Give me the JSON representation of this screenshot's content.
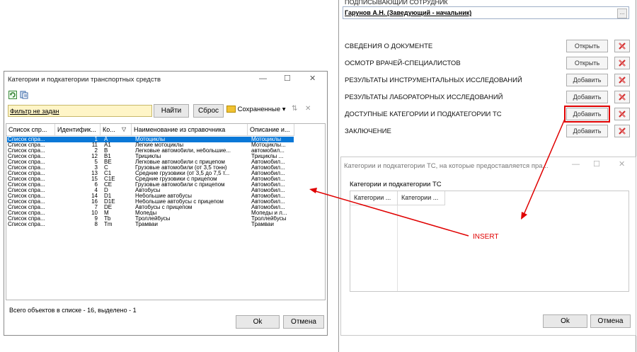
{
  "background_window": {
    "signer_label": "ПОДПИСЫВАЮЩИЙ СОТРУДНИК",
    "signer_value": "Гарунов А.Н. (Заведующий - начальник)",
    "ellipsis": "...",
    "sections": [
      {
        "label": "СВЕДЕНИЯ О ДОКУМЕНТЕ",
        "button": "Открыть"
      },
      {
        "label": "ОСМОТР ВРАЧЕЙ-СПЕЦИАЛИСТОВ",
        "button": "Открыть"
      },
      {
        "label": "РЕЗУЛЬТАТЫ ИНСТРУМЕНТАЛЬНЫХ ИССЛЕДОВАНИЙ",
        "button": "Добавить"
      },
      {
        "label": "РЕЗУЛЬТАТЫ ЛАБОРАТОРНЫХ ИССЛЕДОВАНИЙ",
        "button": "Добавить"
      },
      {
        "label": "ДОСТУПНЫЕ КАТЕГОРИИ И ПОДКАТЕГОРИИ ТС",
        "button": "Добавить"
      },
      {
        "label": "ЗАКЛЮЧЕНИЕ",
        "button": "Добавить"
      }
    ]
  },
  "middle_dialog": {
    "title": "Категории и подкатегории ТС, на которые предоставляется пра...",
    "subtitle": "Категории и подкатегории ТС",
    "columns": [
      "Категории ...",
      "Категории ..."
    ],
    "ok": "Ok",
    "cancel": "Отмена"
  },
  "left_dialog": {
    "title": "Категории и подкатегории транспортных средств",
    "filter_text": "Фильтр не задан",
    "find": "Найти",
    "reset": "Сброс",
    "saved": "Сохраненные",
    "columns": [
      "Список спр...",
      "Идентифик...",
      "Ко...",
      "Наименование из справочника",
      "Описание и..."
    ],
    "rows": [
      [
        "Список спра...",
        "1",
        "A",
        "Мотоциклы",
        "Мотоциклы"
      ],
      [
        "Список спра...",
        "11",
        "A1",
        "Легкие мотоциклы",
        "Мотоциклы..."
      ],
      [
        "Список спра...",
        "2",
        "B",
        "Легковые автомобили, небольшие...",
        "автомобил..."
      ],
      [
        "Список спра...",
        "12",
        "B1",
        "Трициклы",
        "Трициклы ..."
      ],
      [
        "Список спра...",
        "5",
        "BE",
        "Легковые автомобили с прицепом",
        "Автомобил..."
      ],
      [
        "Список спра...",
        "3",
        "C",
        "Грузовые автомобили (от 3,5 тонн)",
        "Автомобил..."
      ],
      [
        "Список спра...",
        "13",
        "C1",
        "Средние грузовики (от 3,5 до 7,5 т...",
        "Автомобил..."
      ],
      [
        "Список спра...",
        "15",
        "C1E",
        "Средние грузовики с прицепом",
        "Автомобил..."
      ],
      [
        "Список спра...",
        "6",
        "CE",
        "Грузовые автомобили с прицепом",
        "Автомобил..."
      ],
      [
        "Список спра...",
        "4",
        "D",
        "Автобусы",
        "Автомобил..."
      ],
      [
        "Список спра...",
        "14",
        "D1",
        "Небольшие автобусы",
        "Автомобил..."
      ],
      [
        "Список спра...",
        "16",
        "D1E",
        "Небольшие автобусы с прицепом",
        "Автомобил..."
      ],
      [
        "Список спра...",
        "7",
        "DE",
        "Автобусы с прицепом",
        "Автомобил..."
      ],
      [
        "Список спра...",
        "10",
        "M",
        "Мопеды",
        "Мопеды и л..."
      ],
      [
        "Список спра...",
        "9",
        "Tb",
        "Троллейбусы",
        "Троллейбусы"
      ],
      [
        "Список спра...",
        "8",
        "Tm",
        "Трамваи",
        "Трамваи"
      ]
    ],
    "selected_row": 0,
    "status": "Всего объектов в списке - 16, выделено - 1",
    "ok": "Ok",
    "cancel": "Отмена"
  },
  "annotation": {
    "label": "INSERT",
    "color": "#e00000"
  }
}
